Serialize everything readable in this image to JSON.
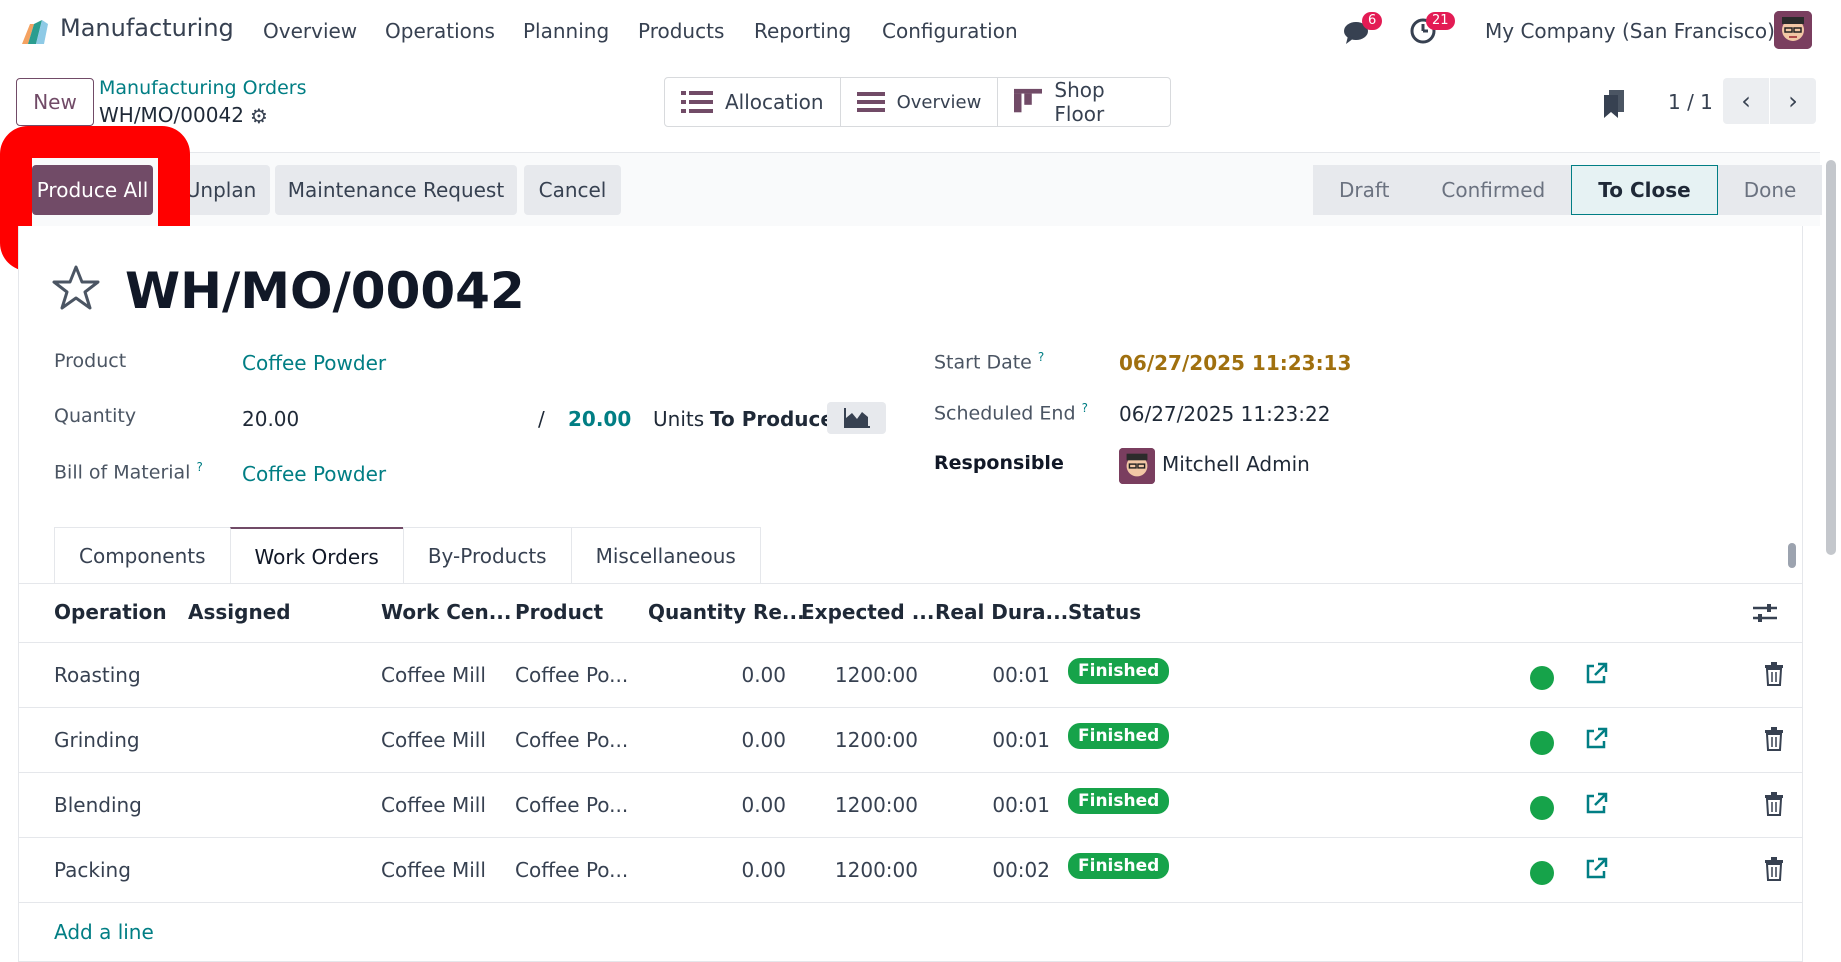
{
  "navbar": {
    "app_name": "Manufacturing",
    "menus": [
      "Overview",
      "Operations",
      "Planning",
      "Products",
      "Reporting",
      "Configuration"
    ],
    "messages_count": "6",
    "activities_count": "21",
    "company": "My Company (San Francisco)"
  },
  "control": {
    "new_label": "New",
    "breadcrumb_parent": "Manufacturing Orders",
    "breadcrumb_current": "WH/MO/00042",
    "views": [
      "Allocation",
      "Overview",
      "Shop Floor"
    ],
    "pager": "1 / 1"
  },
  "actions": {
    "produce_all": "Produce All",
    "unplan": "Unplan",
    "maintenance": "Maintenance Request",
    "cancel": "Cancel"
  },
  "stages": [
    "Draft",
    "Confirmed",
    "To Close",
    "Done"
  ],
  "active_stage": "To Close",
  "form": {
    "title": "WH/MO/00042",
    "product_label": "Product",
    "product": "Coffee Powder",
    "quantity_label": "Quantity",
    "quantity": "20.00",
    "quantity_sep": "/",
    "quantity_total": "20.00",
    "units": "Units",
    "to_produce": "To Produce",
    "bom_label": "Bill of Material",
    "bom": "Coffee Powder",
    "start_label": "Start Date",
    "start": "06/27/2025 11:23:13",
    "end_label": "Scheduled End",
    "end": "06/27/2025 11:23:22",
    "responsible_label": "Responsible",
    "responsible": "Mitchell Admin",
    "help_mark": "?"
  },
  "tabs": [
    "Components",
    "Work Orders",
    "By-Products",
    "Miscellaneous"
  ],
  "active_tab": "Work Orders",
  "table": {
    "headers": [
      "Operation",
      "Assigned",
      "Work Cen...",
      "Product",
      "Quantity Re...",
      "Expected ...",
      "Real Dura...",
      "Status"
    ],
    "rows": [
      {
        "operation": "Roasting",
        "work_center": "Coffee Mill",
        "product": "Coffee Po...",
        "qty": "0.00",
        "expected": "1200:00",
        "real": "00:01",
        "status": "Finished"
      },
      {
        "operation": "Grinding",
        "work_center": "Coffee Mill",
        "product": "Coffee Po...",
        "qty": "0.00",
        "expected": "1200:00",
        "real": "00:01",
        "status": "Finished"
      },
      {
        "operation": "Blending",
        "work_center": "Coffee Mill",
        "product": "Coffee Po...",
        "qty": "0.00",
        "expected": "1200:00",
        "real": "00:01",
        "status": "Finished"
      },
      {
        "operation": "Packing",
        "work_center": "Coffee Mill",
        "product": "Coffee Po...",
        "qty": "0.00",
        "expected": "1200:00",
        "real": "00:02",
        "status": "Finished"
      }
    ],
    "add_line": "Add a line"
  },
  "colors": {
    "brand": "#714b67",
    "link": "#017e84",
    "success": "#16a34a",
    "highlight": "#ff0000"
  }
}
